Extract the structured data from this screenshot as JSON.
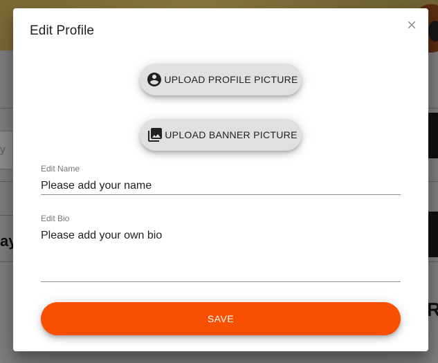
{
  "background_page": {
    "partial_text_left": "y",
    "partial_heading_left": "ay",
    "partial_heading_right": "R"
  },
  "dialog": {
    "title": "Edit Profile",
    "close_icon": "close-icon",
    "upload_profile_button": {
      "label": "UPLOAD PROFILE PICTURE",
      "icon": "account-circle-icon"
    },
    "upload_banner_button": {
      "label": "UPLOAD BANNER PICTURE",
      "icon": "photo-library-icon"
    },
    "name_field": {
      "label": "Edit Name",
      "placeholder": "Please add your name",
      "value": ""
    },
    "bio_field": {
      "label": "Edit Bio",
      "placeholder": "Please add your own bio",
      "value": ""
    },
    "save_button": {
      "label": "SAVE"
    }
  },
  "colors": {
    "accent": "#f85000",
    "button_grey": "#e0e0e0",
    "backdrop": "#7f7f7f"
  }
}
